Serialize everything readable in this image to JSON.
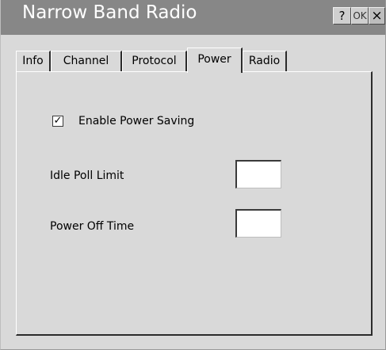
{
  "window": {
    "title": "Narrow Band Radio",
    "buttons": {
      "help": "?",
      "ok": "OK",
      "close": "×"
    }
  },
  "tabs": [
    {
      "label": "Info",
      "active": false
    },
    {
      "label": "Channel",
      "active": false
    },
    {
      "label": "Protocol",
      "active": false
    },
    {
      "label": "Power",
      "active": true
    },
    {
      "label": "Radio",
      "active": false
    }
  ],
  "power": {
    "enable_power_saving": {
      "label": "Enable Power Saving",
      "checked": true,
      "mark": "✓"
    },
    "idle_poll_limit": {
      "label": "Idle Poll Limit",
      "value": ""
    },
    "power_off_time": {
      "label": "Power Off Time",
      "value": ""
    }
  }
}
